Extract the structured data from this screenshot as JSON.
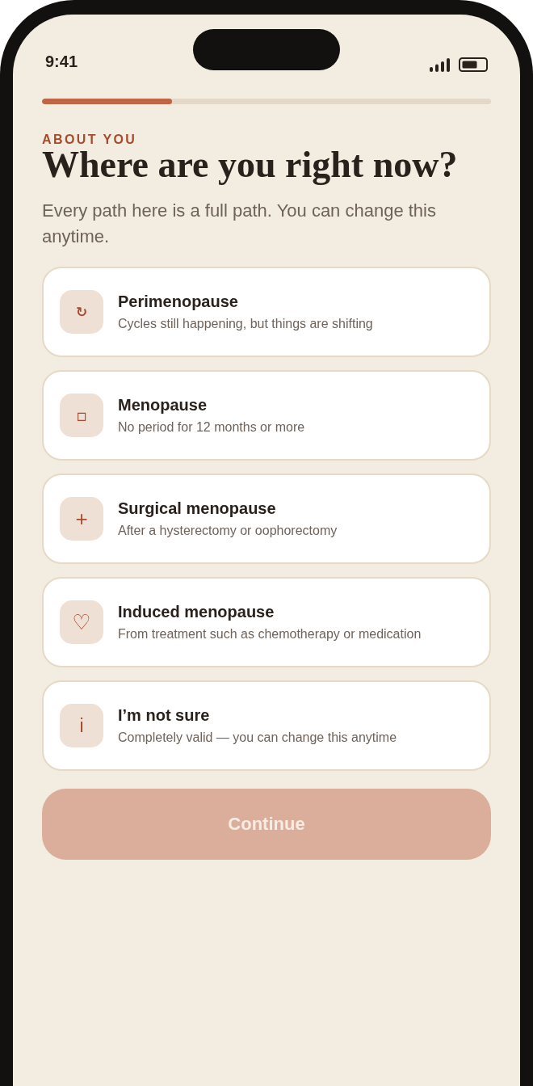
{
  "status_bar": {
    "time": "9:41"
  },
  "progress": {
    "level": 0.29
  },
  "header": {
    "eyebrow": "ABOUT YOU",
    "title": "Where are you right now?",
    "subtitle": "Every path here is a full path. You can change this anytime."
  },
  "options": [
    {
      "icon": "↻",
      "title": "Perimenopause",
      "description": "Cycles still happening, but things are shifting",
      "selected": false
    },
    {
      "icon": "▫",
      "title": "Menopause",
      "description": "No period for 12 months or more",
      "selected": false
    },
    {
      "icon": "+",
      "title": "Surgical menopause",
      "description": "After a hysterectomy or oophorectomy",
      "selected": false
    },
    {
      "icon": "♡",
      "title": "Induced menopause",
      "description": "From treatment such as chemotherapy or medication",
      "selected": false
    },
    {
      "icon": "i",
      "title": "I’m not sure",
      "description": "Completely valid — you can change this anytime",
      "selected": false
    }
  ],
  "continue_button": {
    "label": "Continue",
    "disabled": true
  }
}
